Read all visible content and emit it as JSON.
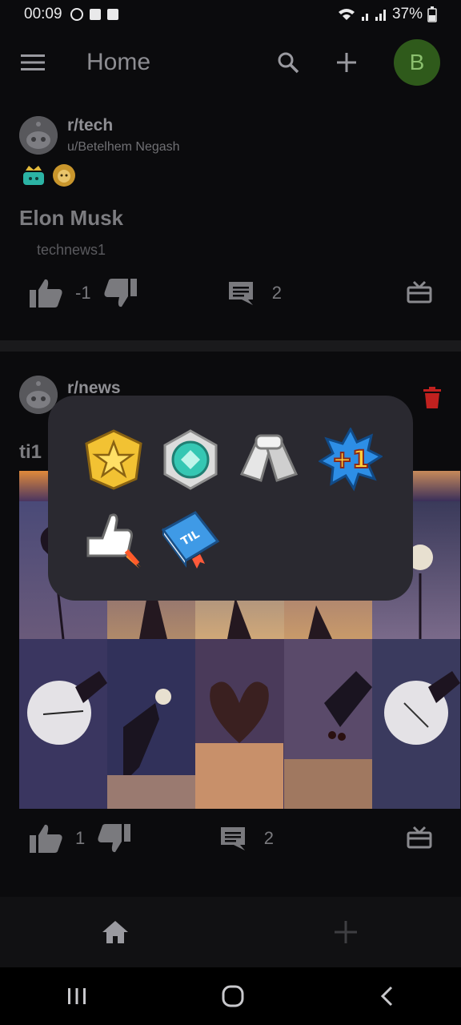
{
  "status_bar": {
    "time": "00:09",
    "battery": "37%"
  },
  "app_bar": {
    "title": "Home",
    "avatar_letter": "B"
  },
  "posts": [
    {
      "subreddit": "r/tech",
      "user": "u/Betelhem Negash",
      "title": "Elon Musk",
      "link": "technews1",
      "score": "-1",
      "comments": "2"
    },
    {
      "subreddit": "r/news",
      "title_partial": "ti1",
      "score": "1",
      "comments": "2"
    }
  ],
  "award_popup": {
    "awards": [
      "star-award-icon",
      "diamond-award-icon",
      "handshake-award-icon",
      "plus-one-award-icon",
      "rocket-like-award-icon",
      "til-book-award-icon"
    ]
  },
  "colors": {
    "accent_avatar": "#2f5a1b",
    "delete": "#c0211f",
    "popup_bg": "#2a2930"
  }
}
